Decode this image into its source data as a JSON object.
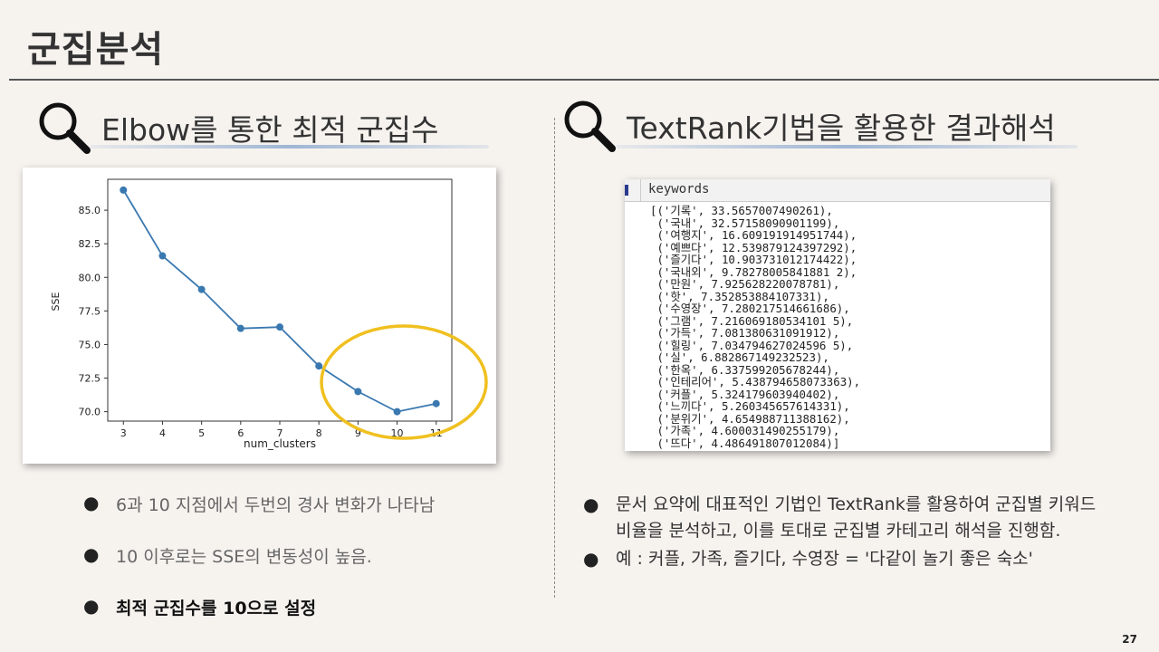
{
  "slide": {
    "title": "군집분석",
    "page_number": "27"
  },
  "left": {
    "heading": "Elbow를 통한 최적 군집수",
    "bullets": [
      "6과 10 지점에서 두번의 경사 변화가 나타남",
      "10 이후로는 SSE의 변동성이 높음.",
      "최적 군집수를 10으로 설정"
    ]
  },
  "right": {
    "heading": "TextRank기법을 활용한 결과해석",
    "keywords_title": "keywords",
    "keyword_lines": [
      "[('기록', 33.5657007490261),",
      " ('국내', 32.57158090901199),",
      " ('여행지', 16.609191914951744),",
      " ('예쁘다', 12.539879124397292),",
      " ('즐기다', 10.903731012174422),",
      " ('국내외', 9.78278005841881 2),",
      " ('만원', 7.925628220078781),",
      " ('핫', 7.352853884107331),",
      " ('수영장', 7.280217514661686),",
      " ('그램', 7.216069180534101 5),",
      " ('가득', 7.081380631091912),",
      " ('힐링', 7.034794627024596 5),",
      " ('실', 6.882867149232523),",
      " ('한옥', 6.337599205678244),",
      " ('인테리어', 5.438794658073363),",
      " ('커플', 5.324179603940402),",
      " ('느끼다', 5.260345657614331),",
      " ('분위기', 4.654988711388162),",
      " ('가족', 4.600031490255179),",
      " ('뜨다', 4.486491807012084)]"
    ],
    "bullets": [
      "문서 요약에 대표적인 기법인 TextRank를 활용하여 군집별 키워드 비율을 분석하고, 이를 토대로 군집별 카테고리 해석을 진행함.",
      "예 : 커플, 가족, 즐기다, 수영장 = '다같이 놀기 좋은 숙소'"
    ]
  },
  "chart_data": {
    "type": "line",
    "xlabel": "num_clusters",
    "ylabel": "SSE",
    "x": [
      3,
      4,
      5,
      6,
      7,
      8,
      9,
      10,
      11
    ],
    "values": [
      86.5,
      81.6,
      79.1,
      76.2,
      76.3,
      73.4,
      71.5,
      70.0,
      70.6
    ],
    "ylim": [
      69.3,
      87.3
    ],
    "xlim": [
      2.6,
      11.4
    ],
    "yticks": [
      70.0,
      72.5,
      75.0,
      77.5,
      80.0,
      82.5,
      85.0
    ],
    "ytick_labels": [
      "70.0",
      "72.5",
      "75.0",
      "77.5",
      "80.0",
      "82.5",
      "85.0"
    ],
    "xticks": [
      3,
      4,
      5,
      6,
      7,
      8,
      9,
      10,
      11
    ],
    "xtick_labels": [
      "3",
      "4",
      "5",
      "6",
      "7",
      "8",
      "9",
      "10",
      "11"
    ],
    "grid": false,
    "line_color": "#3a78b0",
    "highlight_color": "#f0c020"
  },
  "colors": {
    "background": "#f6f3ef",
    "highlight_circle": "#f0c020",
    "line": "#3a78b0"
  },
  "icons": {
    "magnifier": "magnifier-icon"
  }
}
